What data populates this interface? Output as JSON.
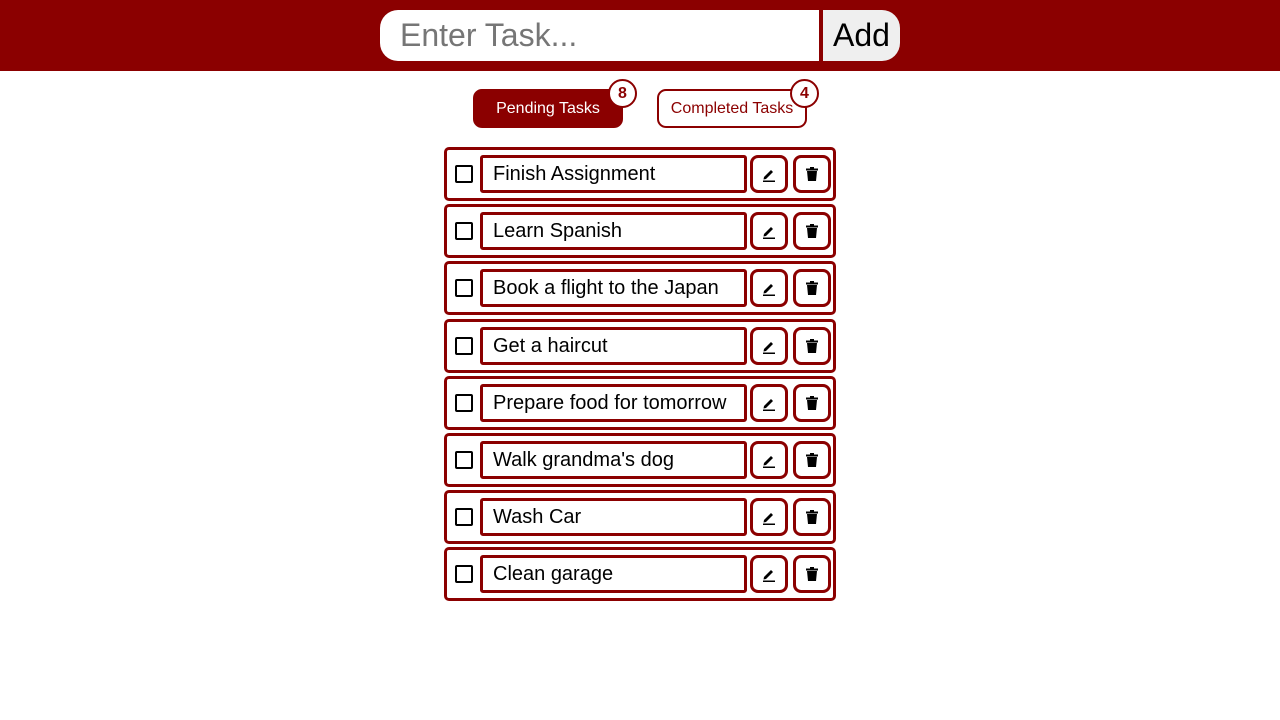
{
  "header": {
    "input": {
      "placeholder": "Enter Task...",
      "value": ""
    },
    "add_label": "Add"
  },
  "tabs": {
    "pending": {
      "label": "Pending Tasks",
      "count": "8"
    },
    "completed": {
      "label": "Completed Tasks",
      "count": "4"
    }
  },
  "tasks": [
    {
      "text": "Finish Assignment",
      "checked": false
    },
    {
      "text": "Learn Spanish",
      "checked": false
    },
    {
      "text": "Book a flight to the Japan",
      "checked": false
    },
    {
      "text": "Get a haircut",
      "checked": false
    },
    {
      "text": "Prepare food for tomorrow",
      "checked": false
    },
    {
      "text": "Walk grandma's dog",
      "checked": false
    },
    {
      "text": "Wash Car",
      "checked": false
    },
    {
      "text": "Clean garage",
      "checked": false
    }
  ],
  "icons": {
    "edit": "pencil-icon",
    "delete": "trash-icon"
  },
  "colors": {
    "accent": "#8b0000",
    "add_button_bg": "#efefef"
  }
}
